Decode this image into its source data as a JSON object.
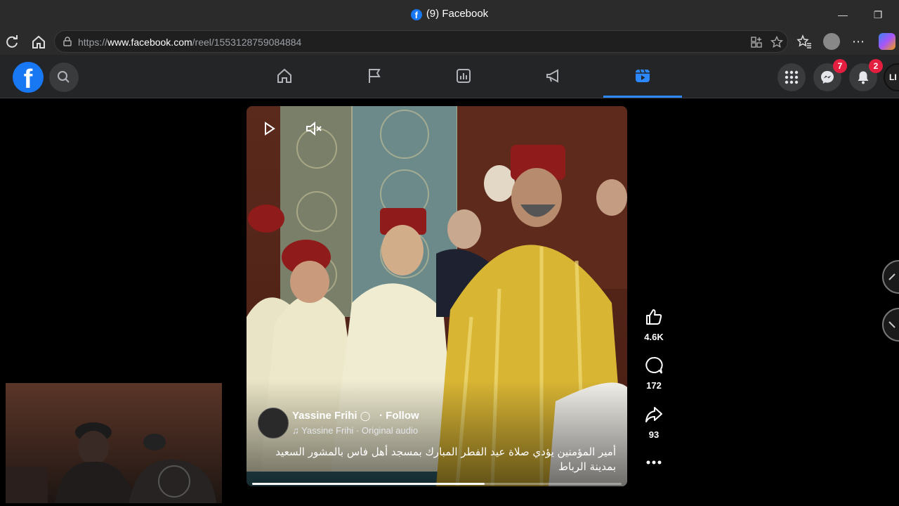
{
  "browser": {
    "window_title": "(9) Facebook",
    "url_prefix": "https://",
    "url_domain": "www.facebook.com",
    "url_path": "/reel/1553128759084884"
  },
  "fb_header": {
    "logo_letter": "f",
    "nav_tabs": [
      "home",
      "pages",
      "dashboard",
      "ads",
      "reels"
    ],
    "active_tab": "reels",
    "messenger_badge": "7",
    "notifications_badge": "2",
    "profile_initials": "LI"
  },
  "reel": {
    "author_name": "Yassine Frihi",
    "follow_label": "· Follow",
    "audio_label": "Yassine Frihi · Original audio",
    "caption": "أمير المؤمنين يؤدي صلاة عيد الفطر المبارك بمسجد أهل فاس بالمشور السعيد بمدينة الرباط",
    "progress": 0.63
  },
  "actions": {
    "likes": "4.6K",
    "comments": "172",
    "shares": "93"
  },
  "colors": {
    "fb_blue": "#1877f2",
    "badge_red": "#e41e3f",
    "active_tab_underline": "#2d88ff"
  }
}
